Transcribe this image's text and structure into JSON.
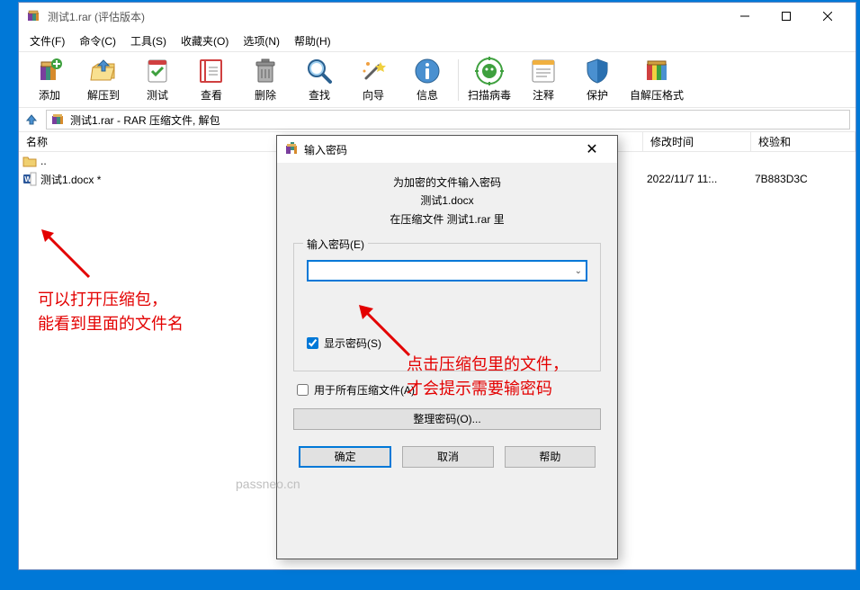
{
  "window": {
    "title": "测试1.rar (评估版本)"
  },
  "menu": {
    "file": "文件(F)",
    "command": "命令(C)",
    "tools": "工具(S)",
    "favorites": "收藏夹(O)",
    "options": "选项(N)",
    "help": "帮助(H)"
  },
  "toolbar": {
    "add": "添加",
    "extract": "解压到",
    "test": "测试",
    "view": "查看",
    "delete": "删除",
    "find": "查找",
    "wizard": "向导",
    "info": "信息",
    "virus": "扫描病毒",
    "comment": "注释",
    "protect": "保护",
    "sfx": "自解压格式"
  },
  "path": {
    "text": "测试1.rar - RAR 压缩文件, 解包"
  },
  "columns": {
    "name": "名称",
    "modified": "修改时间",
    "crc": "校验和"
  },
  "files": {
    "updir": "..",
    "row0": {
      "name": "测试1.docx *",
      "modified": "2022/11/7 11:..",
      "crc": "7B883D3C"
    }
  },
  "dialog": {
    "title": "输入密码",
    "line1": "为加密的文件输入密码",
    "line2": "测试1.docx",
    "line3": "在压缩文件 测试1.rar 里",
    "group_legend": "输入密码(E)",
    "show_pwd": "显示密码(S)",
    "use_all": "用于所有压缩文件(A)",
    "manage": "整理密码(O)...",
    "ok": "确定",
    "cancel": "取消",
    "help": "帮助"
  },
  "annotations": {
    "left1": "可以打开压缩包，",
    "left2": "能看到里面的文件名",
    "right1": "点击压缩包里的文件，",
    "right2": "才会提示需要输密码"
  },
  "watermark": "passneo.cn"
}
